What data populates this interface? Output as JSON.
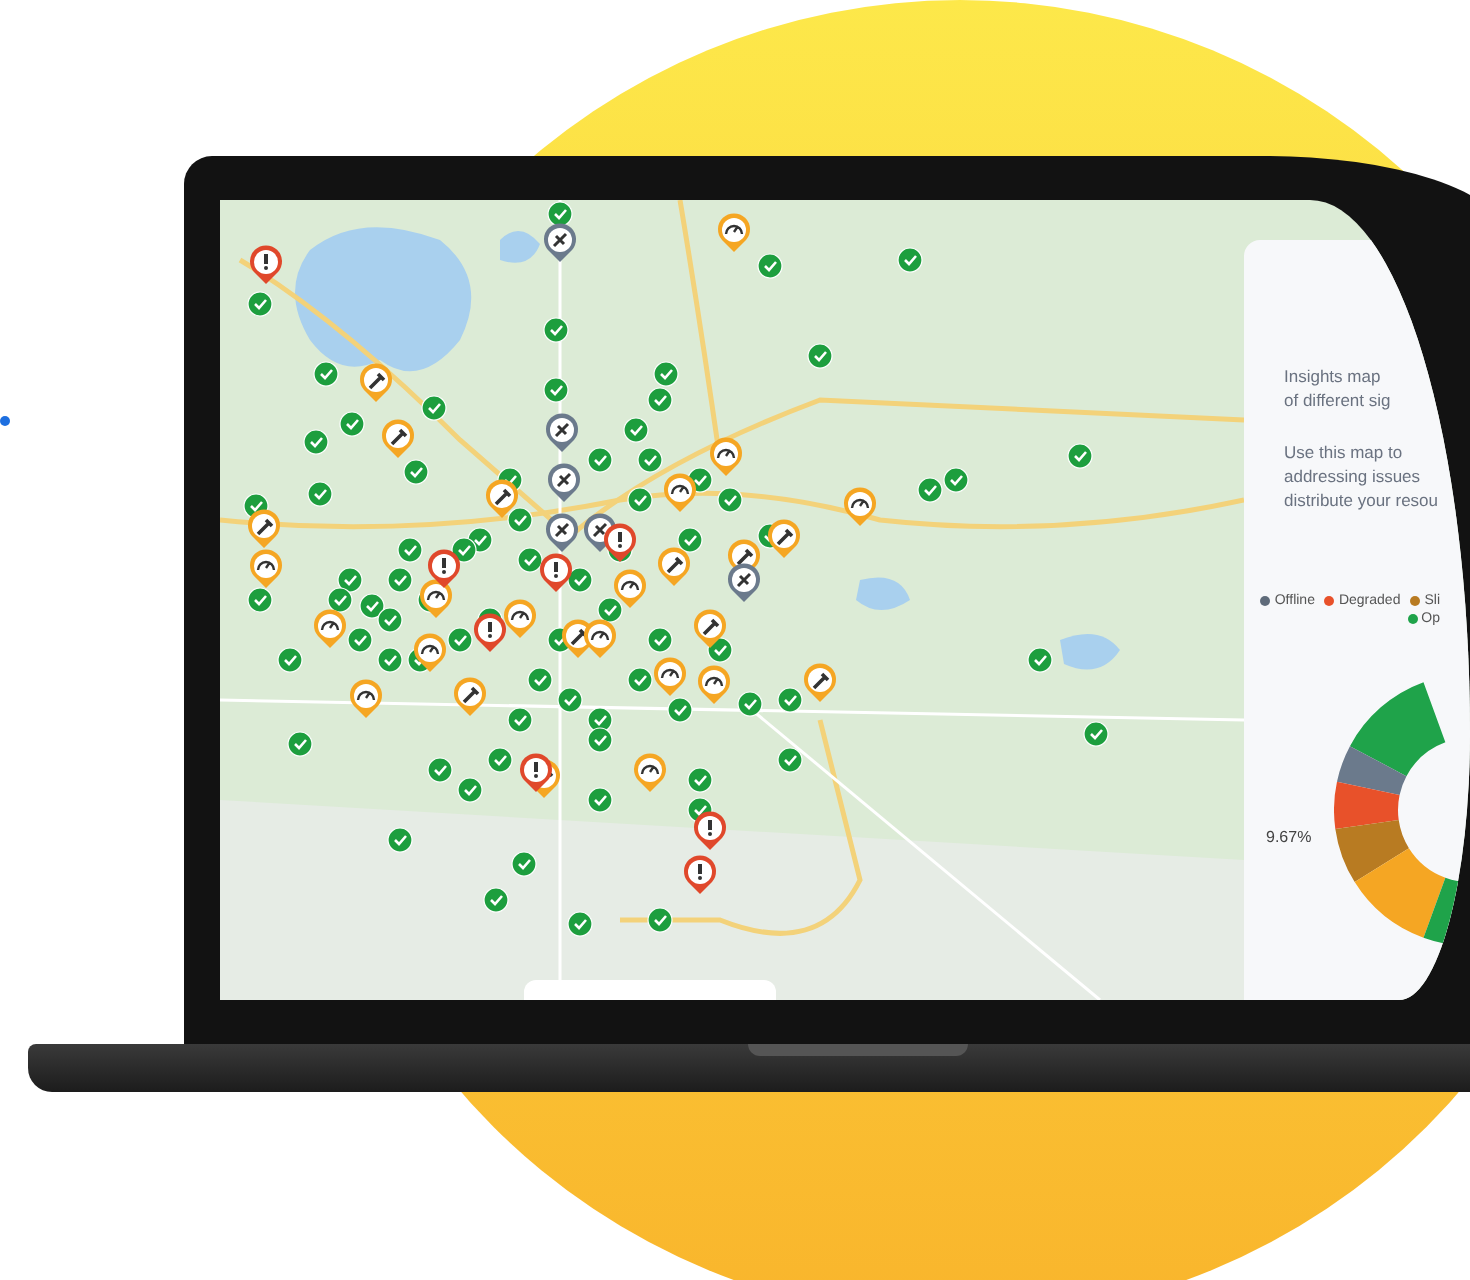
{
  "panel": {
    "paragraphs": [
      [
        "Insights map",
        "of different sig"
      ],
      [
        "Use this map to",
        "addressing issues",
        "distribute your resou"
      ]
    ],
    "legend": [
      {
        "label": "Offline",
        "color": "#5f6b7a"
      },
      {
        "label": "Degraded",
        "color": "#e8512a"
      },
      {
        "label": "Sli",
        "color": "#b87b22"
      },
      {
        "label": "Op",
        "color": "#1fa34a"
      }
    ],
    "donut_label": "9.67%"
  }
}
